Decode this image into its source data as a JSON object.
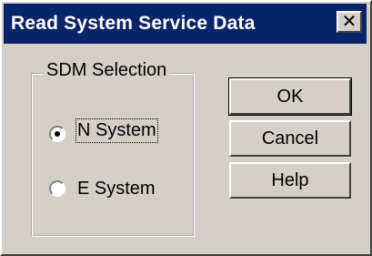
{
  "window": {
    "title": "Read System Service Data",
    "close_glyph": "✕"
  },
  "group": {
    "label": "SDM Selection",
    "options": [
      {
        "label": "N System",
        "selected": true
      },
      {
        "label": "E System",
        "selected": false
      }
    ]
  },
  "buttons": {
    "ok": "OK",
    "cancel": "Cancel",
    "help": "Help"
  },
  "colors": {
    "title_bar": "#0a246a",
    "face": "#d4d0c8"
  }
}
